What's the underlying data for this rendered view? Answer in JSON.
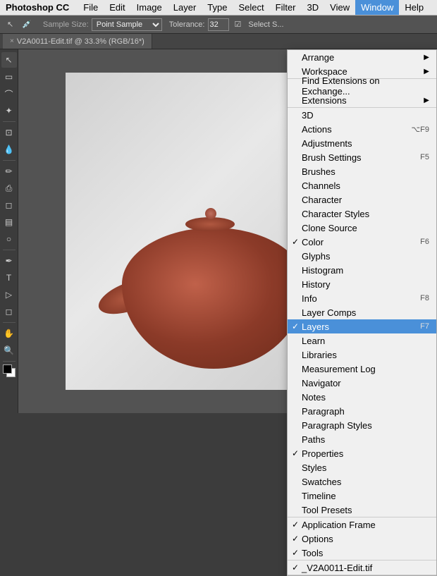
{
  "app": {
    "title": "Photoshop CC"
  },
  "menubar": {
    "items": [
      {
        "label": "Photoshop CC",
        "bold": true
      },
      {
        "label": "File"
      },
      {
        "label": "Edit"
      },
      {
        "label": "Image"
      },
      {
        "label": "Layer"
      },
      {
        "label": "Type"
      },
      {
        "label": "Select"
      },
      {
        "label": "Filter"
      },
      {
        "label": "3D"
      },
      {
        "label": "View"
      },
      {
        "label": "Window",
        "active": true
      },
      {
        "label": "Help"
      }
    ]
  },
  "toolbar": {
    "sample_size_label": "Sample Size:",
    "sample_size_value": "Point Sample",
    "tolerance_label": "Tolerance:",
    "tolerance_value": "32"
  },
  "tab": {
    "filename": "V2A0011-Edit.tif @ 33.3% (RGB/16*)"
  },
  "dropdown": {
    "sections": [
      {
        "items": [
          {
            "label": "Arrange",
            "hasArrow": true
          },
          {
            "label": "Workspace",
            "hasArrow": true
          }
        ]
      },
      {
        "items": [
          {
            "label": "Find Extensions on Exchange..."
          },
          {
            "label": "Extensions",
            "hasArrow": true
          }
        ]
      },
      {
        "items": [
          {
            "label": "3D"
          },
          {
            "label": "Actions",
            "shortcut": "⌥F9"
          },
          {
            "label": "Adjustments"
          },
          {
            "label": "Brush Settings",
            "shortcut": "F5"
          },
          {
            "label": "Brushes"
          },
          {
            "label": "Channels"
          },
          {
            "label": "Character"
          },
          {
            "label": "Character Styles"
          },
          {
            "label": "Clone Source"
          },
          {
            "label": "Color",
            "checked": true,
            "shortcut": "F6"
          },
          {
            "label": "Glyphs"
          },
          {
            "label": "Histogram"
          },
          {
            "label": "History"
          },
          {
            "label": "Info",
            "shortcut": "F8"
          },
          {
            "label": "Layer Comps"
          },
          {
            "label": "Layers",
            "checked": true,
            "highlighted": true,
            "shortcut": "F7"
          },
          {
            "label": "Learn"
          },
          {
            "label": "Libraries"
          },
          {
            "label": "Measurement Log"
          },
          {
            "label": "Navigator"
          },
          {
            "label": "Notes"
          },
          {
            "label": "Paragraph"
          },
          {
            "label": "Paragraph Styles"
          },
          {
            "label": "Paths"
          },
          {
            "label": "Properties",
            "checked": true
          },
          {
            "label": "Styles"
          },
          {
            "label": "Swatches"
          },
          {
            "label": "Timeline"
          },
          {
            "label": "Tool Presets"
          }
        ]
      },
      {
        "items": [
          {
            "label": "Application Frame",
            "checked": true
          },
          {
            "label": "Options",
            "checked": true
          },
          {
            "label": "Tools",
            "checked": true
          }
        ]
      },
      {
        "items": [
          {
            "label": "✓ _V2A0011-Edit.tif"
          }
        ]
      }
    ]
  }
}
